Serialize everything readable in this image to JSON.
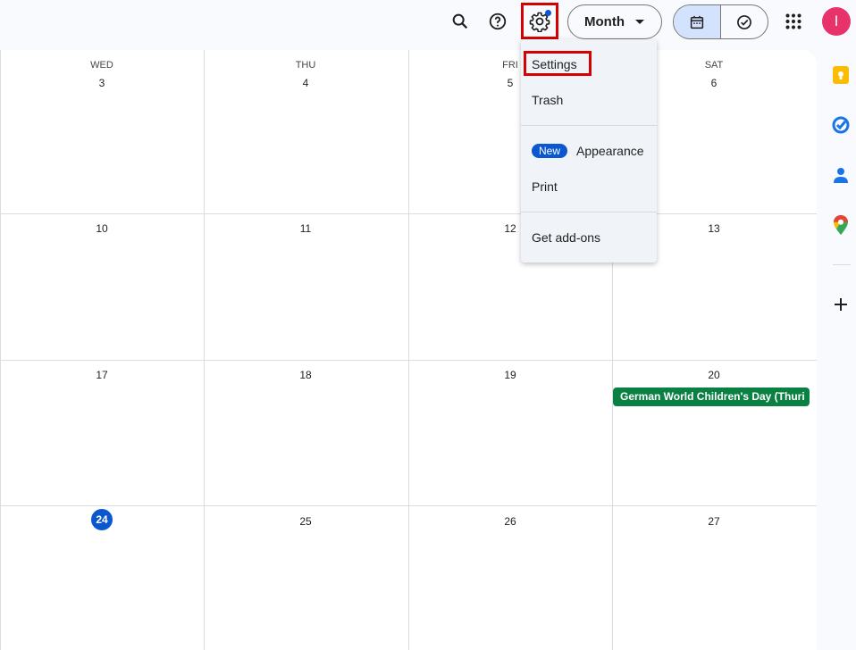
{
  "toolbar": {
    "search_icon": "search-icon",
    "help_icon": "help-icon",
    "settings_icon": "gear-icon",
    "view_select": "Month",
    "apps_icon": "apps-grid-icon",
    "avatar_letter": "I",
    "avatar_color": "#e8336a"
  },
  "calendar": {
    "headers": [
      {
        "dow": "WED",
        "day": "3"
      },
      {
        "dow": "THU",
        "day": "4"
      },
      {
        "dow": "FRI",
        "day": "5"
      },
      {
        "dow": "SAT",
        "day": "6"
      }
    ],
    "weeks": [
      [
        "10",
        "11",
        "12",
        "13"
      ],
      [
        "17",
        "18",
        "19",
        "20"
      ],
      [
        "24",
        "25",
        "26",
        "27"
      ]
    ],
    "today": "24",
    "event": {
      "label": "German World Children's Day (Thuri",
      "color": "#0b8043"
    }
  },
  "settings_menu": {
    "settings": "Settings",
    "trash": "Trash",
    "new_badge": "New",
    "appearance": "Appearance",
    "print": "Print",
    "addons": "Get add-ons"
  },
  "side_panel": [
    "keep-icon",
    "tasks-icon",
    "contacts-icon",
    "maps-icon",
    "add-icon"
  ]
}
